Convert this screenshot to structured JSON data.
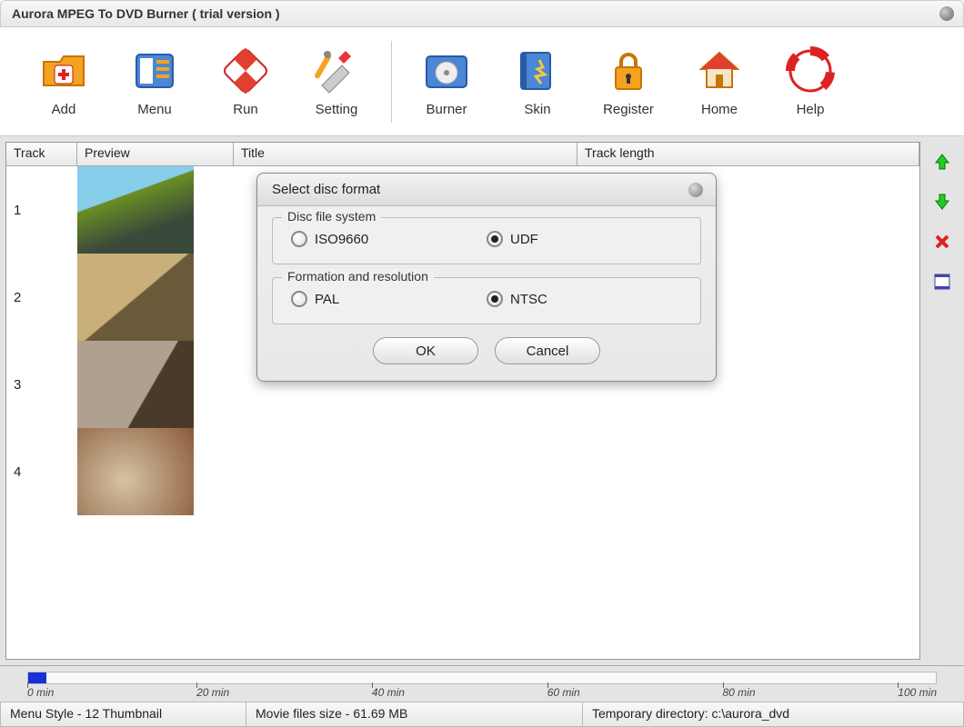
{
  "window": {
    "title": "Aurora MPEG To DVD Burner  ( trial version )"
  },
  "toolbar": [
    {
      "label": "Add",
      "icon": "add-folder-icon"
    },
    {
      "label": "Menu",
      "icon": "menu-icon"
    },
    {
      "label": "Run",
      "icon": "run-icon"
    },
    {
      "label": "Setting",
      "icon": "setting-icon"
    },
    {
      "label": "Burner",
      "icon": "burner-icon"
    },
    {
      "label": "Skin",
      "icon": "skin-icon"
    },
    {
      "label": "Register",
      "icon": "register-icon"
    },
    {
      "label": "Home",
      "icon": "home-icon"
    },
    {
      "label": "Help",
      "icon": "help-icon"
    }
  ],
  "columns": {
    "track": "Track",
    "preview": "Preview",
    "title": "Title",
    "length": "Track length"
  },
  "tracks": [
    {
      "n": "1"
    },
    {
      "n": "2"
    },
    {
      "n": "3"
    },
    {
      "n": "4"
    }
  ],
  "dialog": {
    "title": "Select disc format",
    "fs_legend": "Disc file system",
    "fs_iso": "ISO9660",
    "fs_udf": "UDF",
    "fs_selected": "UDF",
    "fmt_legend": "Formation and resolution",
    "fmt_pal": "PAL",
    "fmt_ntsc": "NTSC",
    "fmt_selected": "NTSC",
    "ok": "OK",
    "cancel": "Cancel"
  },
  "ruler": {
    "ticks": [
      "0 min",
      "20 min",
      "40 min",
      "60 min",
      "80 min",
      "100 min"
    ],
    "fill_percent": 2
  },
  "status": {
    "menu_style": "Menu Style - 12 Thumbnail",
    "file_size": "Movie files size - 61.69 MB",
    "temp_dir": "Temporary directory: c:\\aurora_dvd"
  }
}
